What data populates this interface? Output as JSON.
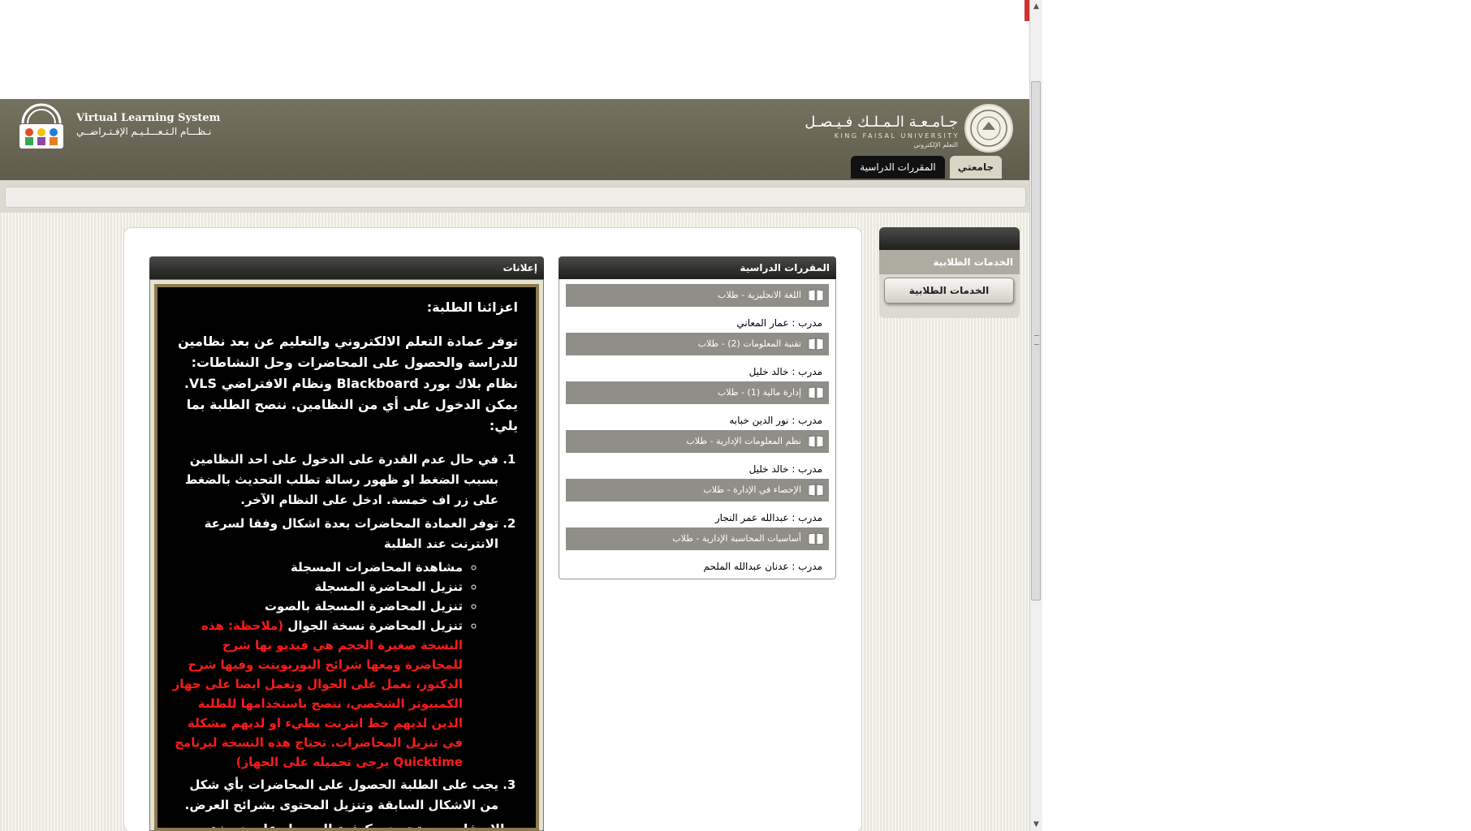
{
  "header": {
    "vls_title": "Virtual Learning System",
    "vls_subtitle": "نـظـــام الـتـعـــلـيـم الإفـتـراضــي",
    "university_ar": "جـامـعـة الـمـلـك فـيـصـل",
    "university_en": "KING FAISAL UNIVERSITY",
    "university_unit": "التعلم الإلكتروني"
  },
  "tabs": {
    "my_university": "جامعتي",
    "courses": "المقررات الدراسية"
  },
  "side_panel": {
    "title": "الخدمات الطلابية",
    "button": "الخدمات الطلابية"
  },
  "courses_panel": {
    "title": "المقررات الدراسية",
    "items": [
      {
        "name": "اللغة الانجليزية - طلاب",
        "instructor": "مدرب : عمار المعاني"
      },
      {
        "name": "تقنية المعلومات (2) - طلاب",
        "instructor": "مدرب : خالد خليل"
      },
      {
        "name": "إدارة مالية (1) - طلاب",
        "instructor": "مدرب : نور الدين خبابه"
      },
      {
        "name": "نظم المعلومات الإدارية - طلاب",
        "instructor": "مدرب : خالد خليل"
      },
      {
        "name": "الإحصاء في الإدارة - طلاب",
        "instructor": "مدرب : عبدالله عمر النجار"
      },
      {
        "name": "أساسيات المحاسبة الإدارية - طلاب",
        "instructor": "مدرب : عدنان عبدالله الملحم"
      }
    ]
  },
  "announcements": {
    "title": "إعلانات",
    "greeting": "اعزائنا الطلبة:",
    "intro": "توفر عمادة التعلم الالكتروني والتعليم عن بعد نظامين للدراسة والحصول على المحاضرات وحل النشاطات: نظام بلاك بورد Blackboard ونظام الافتراضي VLS. يمكن الدخول على أي من النظامين. ننصح الطلبة بما يلي:",
    "item1": "في حال عدم القدرة على الدخول على احد النظامين بسبب الضغط او ظهور رسالة تطلب التحديث بالضغط على زر اف خمسة. ادخل على النظام الآخر.",
    "item2": "توفر العمادة المحاضرات بعدة اشكال وفقا لسرعة الانترنت عند الطلبة",
    "sub1": "مشاهدة المحاضرات المسجلة",
    "sub2": "تنزيل المحاضرة المسجلة",
    "sub3": "تنزيل المحاضرة المسجلة بالصوت",
    "sub4": "تنزيل المحاضرة نسخة الجوال",
    "sub4_note": "(ملاحظة: هذه النسخة صغيرة الحجم هي فيديو بها شرح للمحاضرة ومعها شرائح البوربوينت وفيها شرح الدكتور، تعمل على الجوال وتعمل ايضا على جهاز الكمبيوتر الشخصي، ننصح باستخدامها للطلبة الذين لديهم خط انترنت بطيء او لديهم مشكلة في تنزيل المحاضرات. تحتاج هذه النسخة لبرنامج Quicktime يرجى تحميله على الجهاز)",
    "item3": "يجب على الطلبة الحصول على المحاضرات بأي شكل من الاشكال السابقة وتنزيل المحتوى بشرائح العرض.",
    "footer": "وبالاسفل صورة توضح كيفية الحصول على نسخة الجوال:"
  }
}
